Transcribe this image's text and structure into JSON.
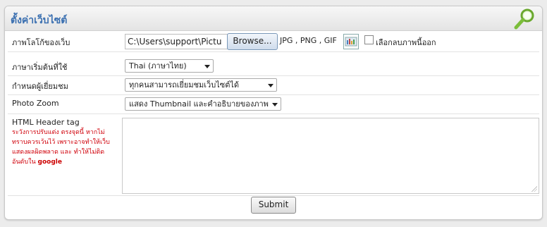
{
  "panel": {
    "title": "ตั้งค่าเว็บไซต์"
  },
  "logo_row": {
    "label": "ภาพโลโก้ของเว็บ",
    "file_value": "C:\\Users\\support\\Pictu",
    "browse_label": "Browse...",
    "formats": "JPG , PNG , GIF",
    "remove_label": "เลือกลบภาพนี้ออก"
  },
  "language_row": {
    "label": "ภาษาเริ่มต้นที่ใช้",
    "selected": "Thai (ภาษาไทย)"
  },
  "visitor_row": {
    "label": "กำหนดผู้เยี่ยมชม",
    "selected": "ทุกคนสามารถเยี่ยมชมเว็บไซต์ได้"
  },
  "zoom_row": {
    "label": "Photo Zoom",
    "selected": "แสดง Thumbnail และคำอธิบายของภาพ"
  },
  "header_row": {
    "label": "HTML Header tag",
    "warning": "ระวังการปรับแต่ง ตรงจุดนี้ หากไม่ทราบควรเว้นไว้ เพราะอาจทำให้เว็บแสดงผลผิดพลาด และ ทำให้ไม่ติดอันดับใน",
    "warning_strong": "google",
    "value": ""
  },
  "submit_label": "Submit",
  "icons": {
    "search": "magnifier-icon",
    "dropdown": "chevron-down-icon",
    "thumbnail": "image-thumbnail-icon",
    "resize": "resize-grip-icon"
  }
}
